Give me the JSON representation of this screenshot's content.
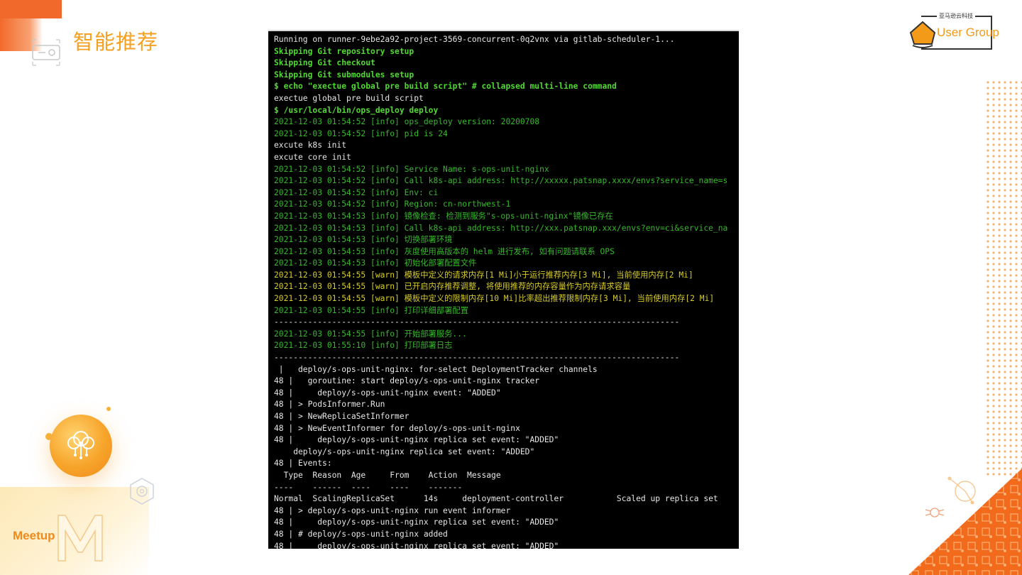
{
  "slide": {
    "title": "智能推荐"
  },
  "logo": {
    "top_text": "亚马逊云科技",
    "text": "User Group"
  },
  "meetup": {
    "label": "Meetup"
  },
  "terminal": {
    "lines": [
      {
        "text": "Running on runner-9ebe2a92-project-3569-concurrent-0q2vnx via gitlab-scheduler-1...",
        "color": "white"
      },
      {
        "text": "Skipping Git repository setup",
        "color": "boldgreen"
      },
      {
        "text": "Skipping Git checkout",
        "color": "boldgreen"
      },
      {
        "text": "Skipping Git submodules setup",
        "color": "boldgreen"
      },
      {
        "text": "$ echo \"exectue global pre build script\" # collapsed multi-line command",
        "color": "boldgreen"
      },
      {
        "text": "exectue global pre build script",
        "color": "white"
      },
      {
        "text": "$ /usr/local/bin/ops_deploy deploy",
        "color": "boldgreen"
      },
      {
        "text": "2021-12-03 01:54:52 [info] ops_deploy version: 20200708",
        "color": "green"
      },
      {
        "text": "2021-12-03 01:54:52 [info] pid is 24",
        "color": "green"
      },
      {
        "text": "excute k8s init",
        "color": "white"
      },
      {
        "text": "excute core init",
        "color": "white"
      },
      {
        "text": "2021-12-03 01:54:52 [info] Service Name: s-ops-unit-nginx",
        "color": "green"
      },
      {
        "text": "2021-12-03 01:54:52 [info] Call k8s-api address: http://xxxxx.patsnap.xxxx/envs?service_name=s",
        "color": "green"
      },
      {
        "text": "2021-12-03 01:54:52 [info] Env: ci",
        "color": "green"
      },
      {
        "text": "2021-12-03 01:54:52 [info] Region: cn-northwest-1",
        "color": "green"
      },
      {
        "text": "2021-12-03 01:54:53 [info] 镜像检查: 检测到服务\"s-ops-unit-nginx\"镜像已存在",
        "color": "green"
      },
      {
        "text": "2021-12-03 01:54:53 [info] Call k8s-api address: http://xxx.patsnap.xxx/envs?env=ci&service_na",
        "color": "green"
      },
      {
        "text": "2021-12-03 01:54:53 [info] 切换部署环境",
        "color": "green"
      },
      {
        "text": "2021-12-03 01:54:53 [info] 灰度使用高版本的 helm 进行发布, 如有问题请联系 OPS",
        "color": "green"
      },
      {
        "text": "2021-12-03 01:54:53 [info] 初始化部署配置文件",
        "color": "green"
      },
      {
        "text": "2021-12-03 01:54:55 [warn] 模板中定义的请求内存[1 Mi]小于运行推荐内存[3 Mi], 当前使用内存[2 Mi]",
        "color": "yellow"
      },
      {
        "text": "2021-12-03 01:54:55 [warn] 已开启内存推荐调整, 将使用推荐的内存容量作为内存请求容量",
        "color": "yellow"
      },
      {
        "text": "2021-12-03 01:54:55 [warn] 模板中定义的限制内存[10 Mi]比率超出推荐限制内存[3 Mi], 当前使用内存[2 Mi]",
        "color": "yellow"
      },
      {
        "text": "2021-12-03 01:54:55 [info] 打印详细部署配置",
        "color": "green"
      },
      {
        "text": "------------------------------------------------------------------------------------",
        "color": "white"
      },
      {
        "text": "2021-12-03 01:54:55 [info] 开始部署服务...",
        "color": "green"
      },
      {
        "text": "2021-12-03 01:55:10 [info] 打印部署日志",
        "color": "green"
      },
      {
        "text": "------------------------------------------------------------------------------------",
        "color": "white"
      },
      {
        "text": " |   deploy/s-ops-unit-nginx: for-select DeploymentTracker channels",
        "color": "white"
      },
      {
        "text": "48 |   goroutine: start deploy/s-ops-unit-nginx tracker",
        "color": "white"
      },
      {
        "text": "48 |     deploy/s-ops-unit-nginx event: \"ADDED\"",
        "color": "white"
      },
      {
        "text": "48 | > PodsInformer.Run",
        "color": "white"
      },
      {
        "text": "48 | > NewReplicaSetInformer",
        "color": "white"
      },
      {
        "text": "48 | > NewEventInformer for deploy/s-ops-unit-nginx",
        "color": "white"
      },
      {
        "text": "48 |     deploy/s-ops-unit-nginx replica set event: \"ADDED\"",
        "color": "white"
      },
      {
        "text": "    deploy/s-ops-unit-nginx replica set event: \"ADDED\"",
        "color": "white"
      },
      {
        "text": "48 | Events:",
        "color": "white"
      },
      {
        "text": "  Type  Reason  Age     From    Action  Message",
        "color": "white"
      },
      {
        "text": "----    ------  ----    ----    -------",
        "color": "white"
      },
      {
        "text": "Normal  ScalingReplicaSet      14s     deployment-controller           Scaled up replica set",
        "color": "white"
      },
      {
        "text": "48 | > deploy/s-ops-unit-nginx run event informer",
        "color": "white"
      },
      {
        "text": "48 |     deploy/s-ops-unit-nginx replica set event: \"ADDED\"",
        "color": "white"
      },
      {
        "text": "48 | # deploy/s-ops-unit-nginx added",
        "color": "white"
      },
      {
        "text": "48 |     deploy/s-ops-unit-nginx replica set event: \"ADDED\"",
        "color": "white"
      }
    ]
  },
  "colors": {
    "accent_orange": "#f26a2b",
    "title_gold": "#f5a020",
    "terminal_bg": "#000000",
    "log_green": "#36b82a",
    "log_yellow": "#d7cc2a"
  }
}
